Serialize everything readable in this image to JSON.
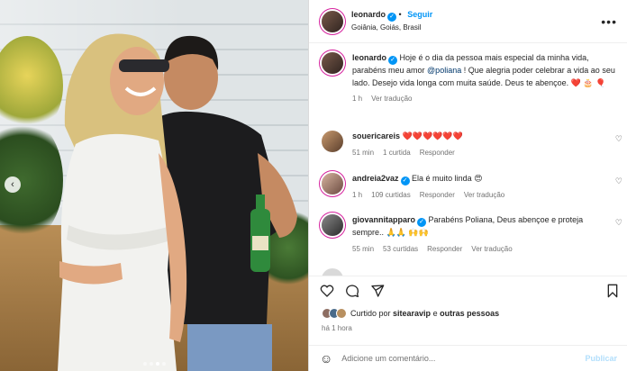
{
  "post": {
    "author": "leonardo",
    "follow_label": "Seguir",
    "location": "Goiânia, Goiás, Brasil",
    "more_icon": "more-horizontal-icon"
  },
  "caption": {
    "username": "leonardo",
    "text_pre": "Hoje é o dia da pessoa mais especial da minha vida, parabéns meu amor ",
    "mention": "@poliana",
    "text_post": " ! Que alegria poder celebrar a vida ao seu lado. Desejo vida longa com muita saúde. Deus te abençoe. ",
    "emojis": "❤️ 🎂 🎈",
    "time": "1 h",
    "translate": "Ver tradução"
  },
  "comments": [
    {
      "username": "souericareis",
      "text": "❤️❤️❤️❤️❤️❤️",
      "time": "51 min",
      "likes": "1 curtida",
      "reply": "Responder",
      "translate": ""
    },
    {
      "username": "andreia2vaz",
      "text": "Ela é muito linda 😍",
      "time": "1 h",
      "likes": "109 curtidas",
      "reply": "Responder",
      "translate": "Ver tradução"
    },
    {
      "username": "giovannitapparo",
      "text": "Parabéns Poliana, Deus abençoe e proteja sempre.. 🙏🙏 🙌🙌",
      "time": "55 min",
      "likes": "53 curtidas",
      "reply": "Responder",
      "translate": "Ver tradução"
    }
  ],
  "likes": {
    "prefix": "Curtido por ",
    "user": "sitearavip",
    "middle": " e ",
    "others": "outras pessoas"
  },
  "post_time": "há 1 hora",
  "add_comment": {
    "placeholder": "Adicione um comentário...",
    "publish": "Publicar"
  },
  "colors": {
    "accent": "#0095f6",
    "heart": "#ed4956"
  }
}
